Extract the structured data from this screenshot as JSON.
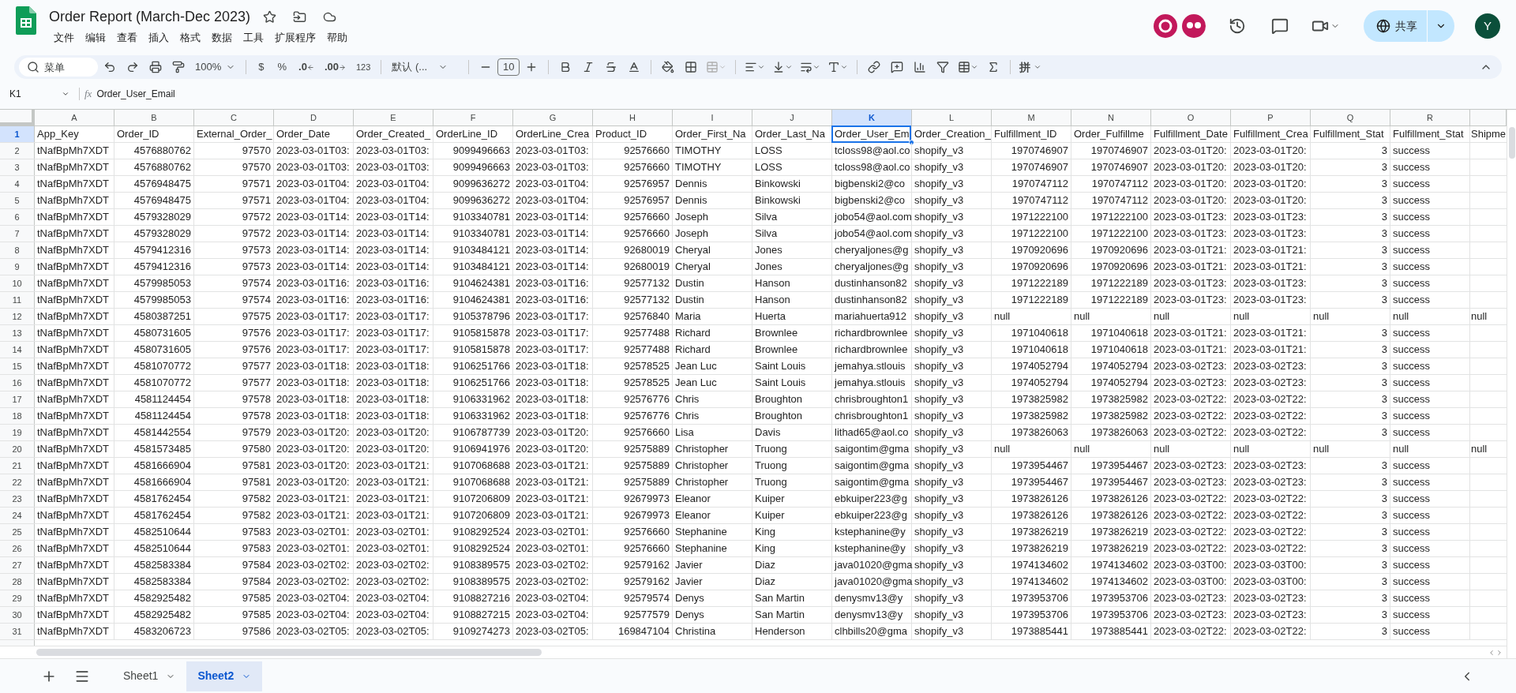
{
  "document": {
    "title": "Order Report (March-Dec 2023)"
  },
  "menu": [
    "文件",
    "编辑",
    "查看",
    "插入",
    "格式",
    "数据",
    "工具",
    "扩展程序",
    "帮助"
  ],
  "share_button": {
    "label": "共享"
  },
  "account": {
    "initial": "Y"
  },
  "toolbar": {
    "search_placeholder": "菜单",
    "zoom": "100%",
    "currency": "$",
    "percent": "%",
    "decrease_decimal": ".0",
    "increase_decimal": ".00",
    "number_format": "123",
    "font": "默认 (...",
    "font_size": "10",
    "input_method": "拼"
  },
  "formula_bar": {
    "cell": "K1",
    "function_label": "fx",
    "formula": "Order_User_Email"
  },
  "table": {
    "columns": [
      {
        "letter": "A",
        "kind": "text",
        "selected": false
      },
      {
        "letter": "B",
        "kind": "number",
        "selected": false
      },
      {
        "letter": "C",
        "kind": "number",
        "selected": false
      },
      {
        "letter": "D",
        "kind": "text",
        "selected": false
      },
      {
        "letter": "E",
        "kind": "text",
        "selected": false
      },
      {
        "letter": "F",
        "kind": "number",
        "selected": false
      },
      {
        "letter": "G",
        "kind": "text",
        "selected": false
      },
      {
        "letter": "H",
        "kind": "number",
        "selected": false
      },
      {
        "letter": "I",
        "kind": "text",
        "selected": false
      },
      {
        "letter": "J",
        "kind": "text",
        "selected": false
      },
      {
        "letter": "K",
        "kind": "text",
        "selected": true
      },
      {
        "letter": "L",
        "kind": "text",
        "selected": false
      },
      {
        "letter": "M",
        "kind": "number",
        "selected": false
      },
      {
        "letter": "N",
        "kind": "number",
        "selected": false
      },
      {
        "letter": "O",
        "kind": "text",
        "selected": false
      },
      {
        "letter": "P",
        "kind": "text",
        "selected": false
      },
      {
        "letter": "Q",
        "kind": "number",
        "selected": false
      },
      {
        "letter": "R",
        "kind": "text",
        "selected": false
      },
      {
        "kind": "text",
        "selected": false
      }
    ],
    "rows": [
      {
        "number": "1",
        "kind": "header",
        "selected": true,
        "cells": [
          "App_Key",
          "Order_ID",
          "External_Order_",
          "Order_Date",
          "Order_Created_",
          "OrderLine_ID",
          "OrderLine_Crea",
          "Product_ID",
          "Order_First_Na",
          "Order_Last_Na",
          "Order_User_Em",
          "Order_Creation_",
          "Fulfillment_ID",
          "Order_Fulfillme",
          "Fulfillment_Date",
          "Fulfillment_Crea",
          "Fulfillment_Stat",
          "Fulfillment_Stat",
          "Shipme"
        ]
      },
      {
        "number": "2",
        "kind": "data",
        "selected": false,
        "cells": [
          "tNafBpMh7XDT",
          "4576880762",
          "97570",
          "2023-03-01T03:",
          "2023-03-01T03:",
          "9099496663",
          "2023-03-01T03:",
          "92576660",
          "TIMOTHY",
          "LOSS",
          "tcloss98@aol.co",
          "shopify_v3",
          "1970746907",
          "1970746907",
          "2023-03-01T20:",
          "2023-03-01T20:",
          "3",
          "success"
        ]
      },
      {
        "number": "3",
        "kind": "data",
        "selected": false,
        "cells": [
          "tNafBpMh7XDT",
          "4576880762",
          "97570",
          "2023-03-01T03:",
          "2023-03-01T03:",
          "9099496663",
          "2023-03-01T03:",
          "92576660",
          "TIMOTHY",
          "LOSS",
          "tcloss98@aol.co",
          "shopify_v3",
          "1970746907",
          "1970746907",
          "2023-03-01T20:",
          "2023-03-01T20:",
          "3",
          "success"
        ]
      },
      {
        "number": "4",
        "kind": "data",
        "selected": false,
        "cells": [
          "tNafBpMh7XDT",
          "4576948475",
          "97571",
          "2023-03-01T04:",
          "2023-03-01T04:",
          "9099636272",
          "2023-03-01T04:",
          "92576957",
          "Dennis",
          "Binkowski",
          "bigbenski2@co",
          "shopify_v3",
          "1970747112",
          "1970747112",
          "2023-03-01T20:",
          "2023-03-01T20:",
          "3",
          "success"
        ]
      },
      {
        "number": "5",
        "kind": "data",
        "selected": false,
        "cells": [
          "tNafBpMh7XDT",
          "4576948475",
          "97571",
          "2023-03-01T04:",
          "2023-03-01T04:",
          "9099636272",
          "2023-03-01T04:",
          "92576957",
          "Dennis",
          "Binkowski",
          "bigbenski2@co",
          "shopify_v3",
          "1970747112",
          "1970747112",
          "2023-03-01T20:",
          "2023-03-01T20:",
          "3",
          "success"
        ]
      },
      {
        "number": "6",
        "kind": "data",
        "selected": false,
        "cells": [
          "tNafBpMh7XDT",
          "4579328029",
          "97572",
          "2023-03-01T14:",
          "2023-03-01T14:",
          "9103340781",
          "2023-03-01T14:",
          "92576660",
          "Joseph",
          "Silva",
          "jobo54@aol.com",
          "shopify_v3",
          "1971222100",
          "1971222100",
          "2023-03-01T23:",
          "2023-03-01T23:",
          "3",
          "success"
        ]
      },
      {
        "number": "7",
        "kind": "data",
        "selected": false,
        "cells": [
          "tNafBpMh7XDT",
          "4579328029",
          "97572",
          "2023-03-01T14:",
          "2023-03-01T14:",
          "9103340781",
          "2023-03-01T14:",
          "92576660",
          "Joseph",
          "Silva",
          "jobo54@aol.com",
          "shopify_v3",
          "1971222100",
          "1971222100",
          "2023-03-01T23:",
          "2023-03-01T23:",
          "3",
          "success"
        ]
      },
      {
        "number": "8",
        "kind": "data",
        "selected": false,
        "cells": [
          "tNafBpMh7XDT",
          "4579412316",
          "97573",
          "2023-03-01T14:",
          "2023-03-01T14:",
          "9103484121",
          "2023-03-01T14:",
          "92680019",
          "Cheryal",
          "Jones",
          "cheryaljones@g",
          "shopify_v3",
          "1970920696",
          "1970920696",
          "2023-03-01T21:",
          "2023-03-01T21:",
          "3",
          "success"
        ]
      },
      {
        "number": "9",
        "kind": "data",
        "selected": false,
        "cells": [
          "tNafBpMh7XDT",
          "4579412316",
          "97573",
          "2023-03-01T14:",
          "2023-03-01T14:",
          "9103484121",
          "2023-03-01T14:",
          "92680019",
          "Cheryal",
          "Jones",
          "cheryaljones@g",
          "shopify_v3",
          "1970920696",
          "1970920696",
          "2023-03-01T21:",
          "2023-03-01T21:",
          "3",
          "success"
        ]
      },
      {
        "number": "10",
        "kind": "data",
        "selected": false,
        "cells": [
          "tNafBpMh7XDT",
          "4579985053",
          "97574",
          "2023-03-01T16:",
          "2023-03-01T16:",
          "9104624381",
          "2023-03-01T16:",
          "92577132",
          "Dustin",
          "Hanson",
          "dustinhanson82",
          "shopify_v3",
          "1971222189",
          "1971222189",
          "2023-03-01T23:",
          "2023-03-01T23:",
          "3",
          "success"
        ]
      },
      {
        "number": "11",
        "kind": "data",
        "selected": false,
        "cells": [
          "tNafBpMh7XDT",
          "4579985053",
          "97574",
          "2023-03-01T16:",
          "2023-03-01T16:",
          "9104624381",
          "2023-03-01T16:",
          "92577132",
          "Dustin",
          "Hanson",
          "dustinhanson82",
          "shopify_v3",
          "1971222189",
          "1971222189",
          "2023-03-01T23:",
          "2023-03-01T23:",
          "3",
          "success"
        ]
      },
      {
        "number": "12",
        "kind": "null_fulfillment",
        "selected": false,
        "cells": [
          "tNafBpMh7XDT",
          "4580387251",
          "97575",
          "2023-03-01T17:",
          "2023-03-01T17:",
          "9105378796",
          "2023-03-01T17:",
          "92576840",
          "Maria",
          "Huerta",
          "mariahuerta912",
          "shopify_v3",
          "null",
          "null",
          "null",
          "null",
          "null",
          "null",
          "null"
        ]
      },
      {
        "number": "13",
        "kind": "data",
        "selected": false,
        "cells": [
          "tNafBpMh7XDT",
          "4580731605",
          "97576",
          "2023-03-01T17:",
          "2023-03-01T17:",
          "9105815878",
          "2023-03-01T17:",
          "92577488",
          "Richard",
          "Brownlee",
          "richardbrownlee",
          "shopify_v3",
          "1971040618",
          "1971040618",
          "2023-03-01T21:",
          "2023-03-01T21:",
          "3",
          "success"
        ]
      },
      {
        "number": "14",
        "kind": "data",
        "selected": false,
        "cells": [
          "tNafBpMh7XDT",
          "4580731605",
          "97576",
          "2023-03-01T17:",
          "2023-03-01T17:",
          "9105815878",
          "2023-03-01T17:",
          "92577488",
          "Richard",
          "Brownlee",
          "richardbrownlee",
          "shopify_v3",
          "1971040618",
          "1971040618",
          "2023-03-01T21:",
          "2023-03-01T21:",
          "3",
          "success"
        ]
      },
      {
        "number": "15",
        "kind": "data",
        "selected": false,
        "cells": [
          "tNafBpMh7XDT",
          "4581070772",
          "97577",
          "2023-03-01T18:",
          "2023-03-01T18:",
          "9106251766",
          "2023-03-01T18:",
          "92578525",
          "Jean Luc",
          "Saint Louis",
          "jemahya.stlouis",
          "shopify_v3",
          "1974052794",
          "1974052794",
          "2023-03-02T23:",
          "2023-03-02T23:",
          "3",
          "success"
        ]
      },
      {
        "number": "16",
        "kind": "data",
        "selected": false,
        "cells": [
          "tNafBpMh7XDT",
          "4581070772",
          "97577",
          "2023-03-01T18:",
          "2023-03-01T18:",
          "9106251766",
          "2023-03-01T18:",
          "92578525",
          "Jean Luc",
          "Saint Louis",
          "jemahya.stlouis",
          "shopify_v3",
          "1974052794",
          "1974052794",
          "2023-03-02T23:",
          "2023-03-02T23:",
          "3",
          "success"
        ]
      },
      {
        "number": "17",
        "kind": "data",
        "selected": false,
        "cells": [
          "tNafBpMh7XDT",
          "4581124454",
          "97578",
          "2023-03-01T18:",
          "2023-03-01T18:",
          "9106331962",
          "2023-03-01T18:",
          "92576776",
          "Chris",
          "Broughton",
          "chrisbroughton1",
          "shopify_v3",
          "1973825982",
          "1973825982",
          "2023-03-02T22:",
          "2023-03-02T22:",
          "3",
          "success"
        ]
      },
      {
        "number": "18",
        "kind": "data",
        "selected": false,
        "cells": [
          "tNafBpMh7XDT",
          "4581124454",
          "97578",
          "2023-03-01T18:",
          "2023-03-01T18:",
          "9106331962",
          "2023-03-01T18:",
          "92576776",
          "Chris",
          "Broughton",
          "chrisbroughton1",
          "shopify_v3",
          "1973825982",
          "1973825982",
          "2023-03-02T22:",
          "2023-03-02T22:",
          "3",
          "success"
        ]
      },
      {
        "number": "19",
        "kind": "data",
        "selected": false,
        "cells": [
          "tNafBpMh7XDT",
          "4581442554",
          "97579",
          "2023-03-01T20:",
          "2023-03-01T20:",
          "9106787739",
          "2023-03-01T20:",
          "92576660",
          "Lisa",
          "Davis",
          "lithad65@aol.co",
          "shopify_v3",
          "1973826063",
          "1973826063",
          "2023-03-02T22:",
          "2023-03-02T22:",
          "3",
          "success"
        ]
      },
      {
        "number": "20",
        "kind": "null_fulfillment",
        "selected": false,
        "cells": [
          "tNafBpMh7XDT",
          "4581573485",
          "97580",
          "2023-03-01T20:",
          "2023-03-01T20:",
          "9106941976",
          "2023-03-01T20:",
          "92575889",
          "Christopher",
          "Truong",
          "saigontim@gma",
          "shopify_v3",
          "null",
          "null",
          "null",
          "null",
          "null",
          "null",
          "null"
        ]
      },
      {
        "number": "21",
        "kind": "data",
        "selected": false,
        "cells": [
          "tNafBpMh7XDT",
          "4581666904",
          "97581",
          "2023-03-01T20:",
          "2023-03-01T21:",
          "9107068688",
          "2023-03-01T21:",
          "92575889",
          "Christopher",
          "Truong",
          "saigontim@gma",
          "shopify_v3",
          "1973954467",
          "1973954467",
          "2023-03-02T23:",
          "2023-03-02T23:",
          "3",
          "success"
        ]
      },
      {
        "number": "22",
        "kind": "data",
        "selected": false,
        "cells": [
          "tNafBpMh7XDT",
          "4581666904",
          "97581",
          "2023-03-01T20:",
          "2023-03-01T21:",
          "9107068688",
          "2023-03-01T21:",
          "92575889",
          "Christopher",
          "Truong",
          "saigontim@gma",
          "shopify_v3",
          "1973954467",
          "1973954467",
          "2023-03-02T23:",
          "2023-03-02T23:",
          "3",
          "success"
        ]
      },
      {
        "number": "23",
        "kind": "data",
        "selected": false,
        "cells": [
          "tNafBpMh7XDT",
          "4581762454",
          "97582",
          "2023-03-01T21:",
          "2023-03-01T21:",
          "9107206809",
          "2023-03-01T21:",
          "92679973",
          "Eleanor",
          "Kuiper",
          "ebkuiper223@g",
          "shopify_v3",
          "1973826126",
          "1973826126",
          "2023-03-02T22:",
          "2023-03-02T22:",
          "3",
          "success"
        ]
      },
      {
        "number": "24",
        "kind": "data",
        "selected": false,
        "cells": [
          "tNafBpMh7XDT",
          "4581762454",
          "97582",
          "2023-03-01T21:",
          "2023-03-01T21:",
          "9107206809",
          "2023-03-01T21:",
          "92679973",
          "Eleanor",
          "Kuiper",
          "ebkuiper223@g",
          "shopify_v3",
          "1973826126",
          "1973826126",
          "2023-03-02T22:",
          "2023-03-02T22:",
          "3",
          "success"
        ]
      },
      {
        "number": "25",
        "kind": "data",
        "selected": false,
        "cells": [
          "tNafBpMh7XDT",
          "4582510644",
          "97583",
          "2023-03-02T01:",
          "2023-03-02T01:",
          "9108292524",
          "2023-03-02T01:",
          "92576660",
          "Stephanine",
          "King",
          "kstephanine@y",
          "shopify_v3",
          "1973826219",
          "1973826219",
          "2023-03-02T22:",
          "2023-03-02T22:",
          "3",
          "success"
        ]
      },
      {
        "number": "26",
        "kind": "data",
        "selected": false,
        "cells": [
          "tNafBpMh7XDT",
          "4582510644",
          "97583",
          "2023-03-02T01:",
          "2023-03-02T01:",
          "9108292524",
          "2023-03-02T01:",
          "92576660",
          "Stephanine",
          "King",
          "kstephanine@y",
          "shopify_v3",
          "1973826219",
          "1973826219",
          "2023-03-02T22:",
          "2023-03-02T22:",
          "3",
          "success"
        ]
      },
      {
        "number": "27",
        "kind": "data",
        "selected": false,
        "cells": [
          "tNafBpMh7XDT",
          "4582583384",
          "97584",
          "2023-03-02T02:",
          "2023-03-02T02:",
          "9108389575",
          "2023-03-02T02:",
          "92579162",
          "Javier",
          "Diaz",
          "java01020@gma",
          "shopify_v3",
          "1974134602",
          "1974134602",
          "2023-03-03T00:",
          "2023-03-03T00:",
          "3",
          "success"
        ]
      },
      {
        "number": "28",
        "kind": "data",
        "selected": false,
        "cells": [
          "tNafBpMh7XDT",
          "4582583384",
          "97584",
          "2023-03-02T02:",
          "2023-03-02T02:",
          "9108389575",
          "2023-03-02T02:",
          "92579162",
          "Javier",
          "Diaz",
          "java01020@gma",
          "shopify_v3",
          "1974134602",
          "1974134602",
          "2023-03-03T00:",
          "2023-03-03T00:",
          "3",
          "success"
        ]
      },
      {
        "number": "29",
        "kind": "data",
        "selected": false,
        "cells": [
          "tNafBpMh7XDT",
          "4582925482",
          "97585",
          "2023-03-02T04:",
          "2023-03-02T04:",
          "9108827216",
          "2023-03-02T04:",
          "92579574",
          "Denys",
          "San Martin",
          "denysmv13@y",
          "shopify_v3",
          "1973953706",
          "1973953706",
          "2023-03-02T23:",
          "2023-03-02T23:",
          "3",
          "success"
        ]
      },
      {
        "number": "30",
        "kind": "data",
        "selected": false,
        "cells": [
          "tNafBpMh7XDT",
          "4582925482",
          "97585",
          "2023-03-02T04:",
          "2023-03-02T04:",
          "9108827215",
          "2023-03-02T04:",
          "92577579",
          "Denys",
          "San Martin",
          "denysmv13@y",
          "shopify_v3",
          "1973953706",
          "1973953706",
          "2023-03-02T23:",
          "2023-03-02T23:",
          "3",
          "success"
        ]
      },
      {
        "number": "31",
        "kind": "data",
        "selected": false,
        "cells": [
          "tNafBpMh7XDT",
          "4583206723",
          "97586",
          "2023-03-02T05:",
          "2023-03-02T05:",
          "9109274273",
          "2023-03-02T05:",
          "169847104",
          "Christina",
          "Henderson",
          "clhbills20@gma",
          "shopify_v3",
          "1973885441",
          "1973885441",
          "2023-03-02T22:",
          "2023-03-02T22:",
          "3",
          "success"
        ]
      }
    ]
  },
  "sheet_tabs": [
    {
      "label": "Sheet1",
      "selected": false
    },
    {
      "label": "Sheet2",
      "selected": true
    }
  ]
}
